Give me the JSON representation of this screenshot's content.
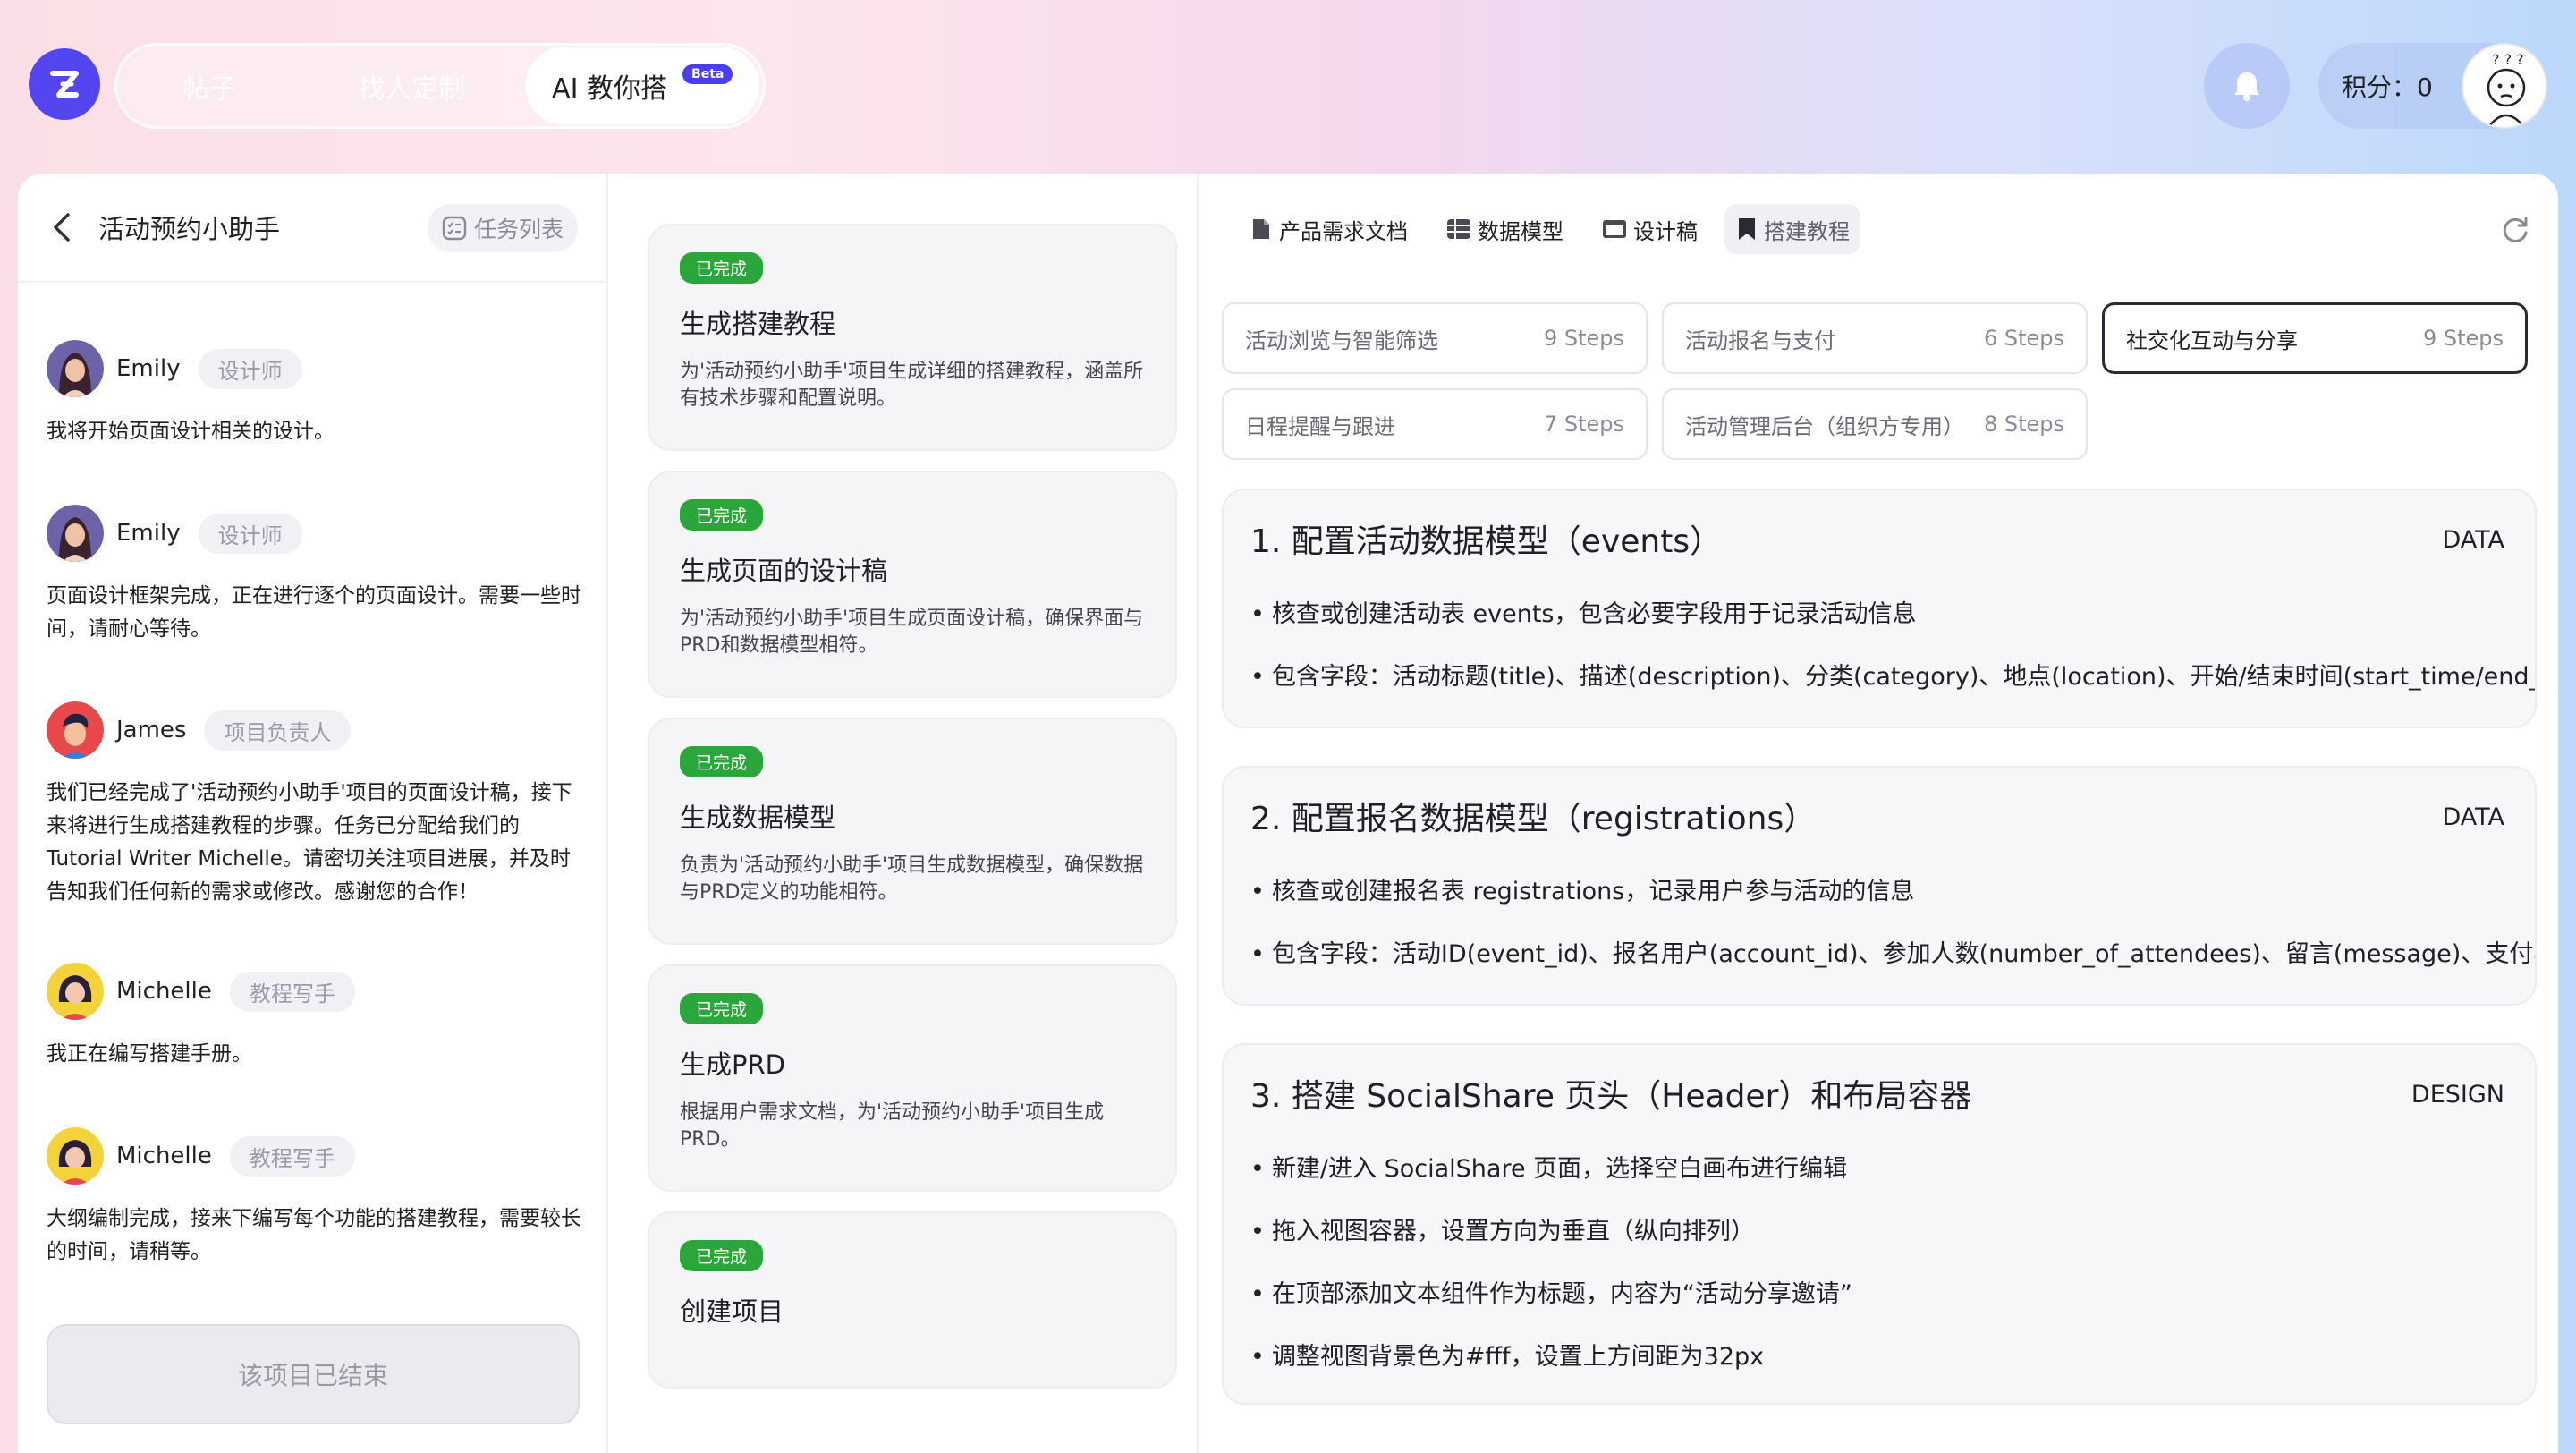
{
  "nav": {
    "tabs": [
      {
        "label": "帖子"
      },
      {
        "label": "找人定制"
      },
      {
        "label": "AI 教你搭",
        "badge": "Beta"
      }
    ],
    "points_label": "积分：0"
  },
  "project": {
    "title": "活动预约小助手",
    "task_list_label": "任务列表",
    "ended_label": "该项目已结束"
  },
  "messages": [
    {
      "name": "Emily",
      "role": "设计师",
      "text": "我将开始页面设计相关的设计。"
    },
    {
      "name": "Emily",
      "role": "设计师",
      "text": "页面设计框架完成，正在进行逐个的页面设计。需要一些时间，请耐心等待。"
    },
    {
      "name": "James",
      "role": "项目负责人",
      "text": "我们已经完成了'活动预约小助手'项目的页面设计稿，接下来将进行生成搭建教程的步骤。任务已分配给我们的Tutorial Writer Michelle。请密切关注项目进展，并及时告知我们任何新的需求或修改。感谢您的合作！"
    },
    {
      "name": "Michelle",
      "role": "教程写手",
      "text": "我正在编写搭建手册。"
    },
    {
      "name": "Michelle",
      "role": "教程写手",
      "text": "大纲编制完成，接来下编写每个功能的搭建教程，需要较长的时间，请稍等。"
    }
  ],
  "steps": [
    {
      "status": "已完成",
      "title": "生成搭建教程",
      "desc": "为'活动预约小助手'项目生成详细的搭建教程，涵盖所有技术步骤和配置说明。"
    },
    {
      "status": "已完成",
      "title": "生成页面的设计稿",
      "desc": "为'活动预约小助手'项目生成页面设计稿，确保界面与PRD和数据模型相符。"
    },
    {
      "status": "已完成",
      "title": "生成数据模型",
      "desc": "负责为'活动预约小助手'项目生成数据模型，确保数据与PRD定义的功能相符。"
    },
    {
      "status": "已完成",
      "title": "生成PRD",
      "desc": "根据用户需求文档，为'活动预约小助手'项目生成PRD。"
    },
    {
      "status": "已完成",
      "title": "创建项目",
      "desc": ""
    }
  ],
  "doc_tabs": [
    {
      "label": "产品需求文档",
      "icon": "document-icon"
    },
    {
      "label": "数据模型",
      "icon": "table-icon"
    },
    {
      "label": "设计稿",
      "icon": "window-icon"
    },
    {
      "label": "搭建教程",
      "icon": "bookmark-icon"
    }
  ],
  "modules": [
    {
      "label": "活动浏览与智能筛选",
      "steps": "9 Steps"
    },
    {
      "label": "活动报名与支付",
      "steps": "6 Steps"
    },
    {
      "label": "社交化互动与分享",
      "steps": "9 Steps"
    },
    {
      "label": "日程提醒与跟进",
      "steps": "7 Steps"
    },
    {
      "label": "活动管理后台（组织方专用）",
      "steps": "8 Steps"
    }
  ],
  "sections": [
    {
      "title": "1. 配置活动数据模型（events）",
      "type": "DATA",
      "bullets": [
        "核查或创建活动表 events，包含必要字段用于记录活动信息",
        "包含字段：活动标题(title)、描述(description)、分类(category)、地点(location)、开始/结束时间(start_time/end_time)"
      ]
    },
    {
      "title": "2. 配置报名数据模型（registrations）",
      "type": "DATA",
      "bullets": [
        "核查或创建报名表 registrations，记录用户参与活动的信息",
        "包含字段：活动ID(event_id)、报名用户(account_id)、参加人数(number_of_attendees)、留言(message)、支付状态"
      ]
    },
    {
      "title": "3. 搭建 SocialShare 页头（Header）和布局容器",
      "type": "DESIGN",
      "bullets": [
        "新建/进入 SocialShare 页面，选择空白画布进行编辑",
        "拖入视图容器，设置方向为垂直（纵向排列）",
        "在顶部添加文本组件作为标题，内容为“活动分享邀请”",
        "调整视图背景色为#fff，设置上方间距为32px"
      ]
    }
  ],
  "colors": {
    "brand": "#5346f0",
    "done": "#2aa63a"
  }
}
